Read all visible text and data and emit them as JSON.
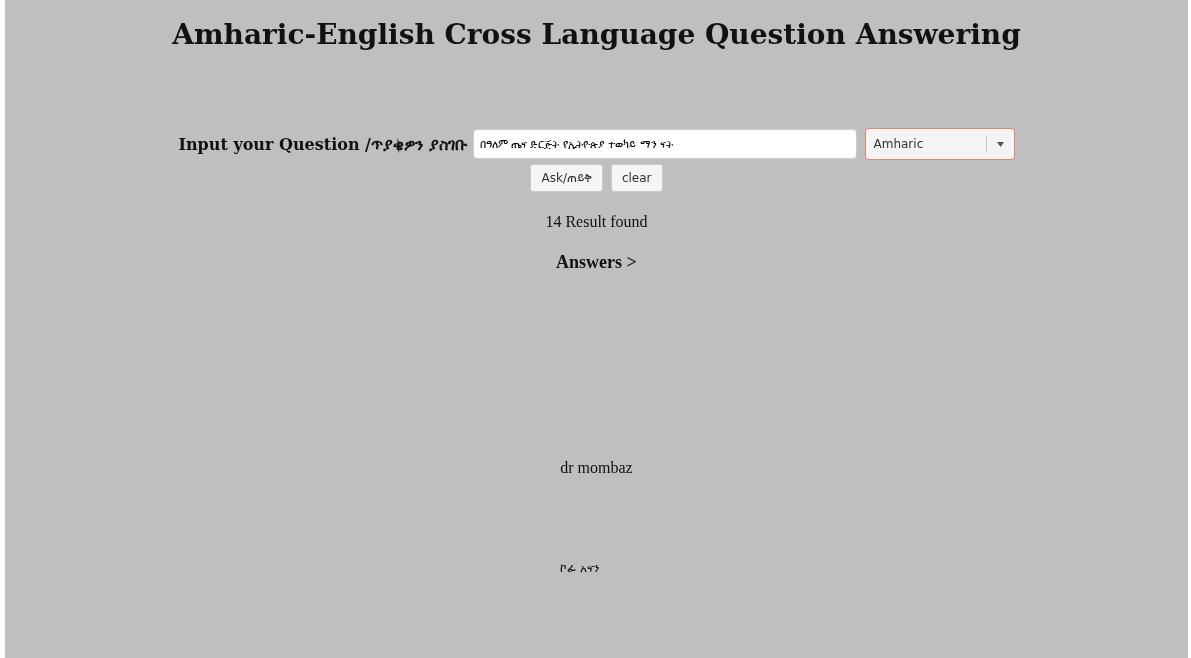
{
  "title": "Amharic-English Cross Language Question Answering",
  "question_label": "Input your Question /ጥያቄዎን ያስገቡ",
  "question_field": {
    "value": "በዓለም ጤና ድርጅት የኢትዮጵያ ተወካይ ማን ናት"
  },
  "language_select": {
    "value": "Amharic"
  },
  "buttons": [
    "Ask/ጠይቅ",
    "clear"
  ],
  "result_count": "14 Result found",
  "answers_heading": "Answers >",
  "answers": [
    "dr mombaz",
    "ኮፊ አናን"
  ]
}
